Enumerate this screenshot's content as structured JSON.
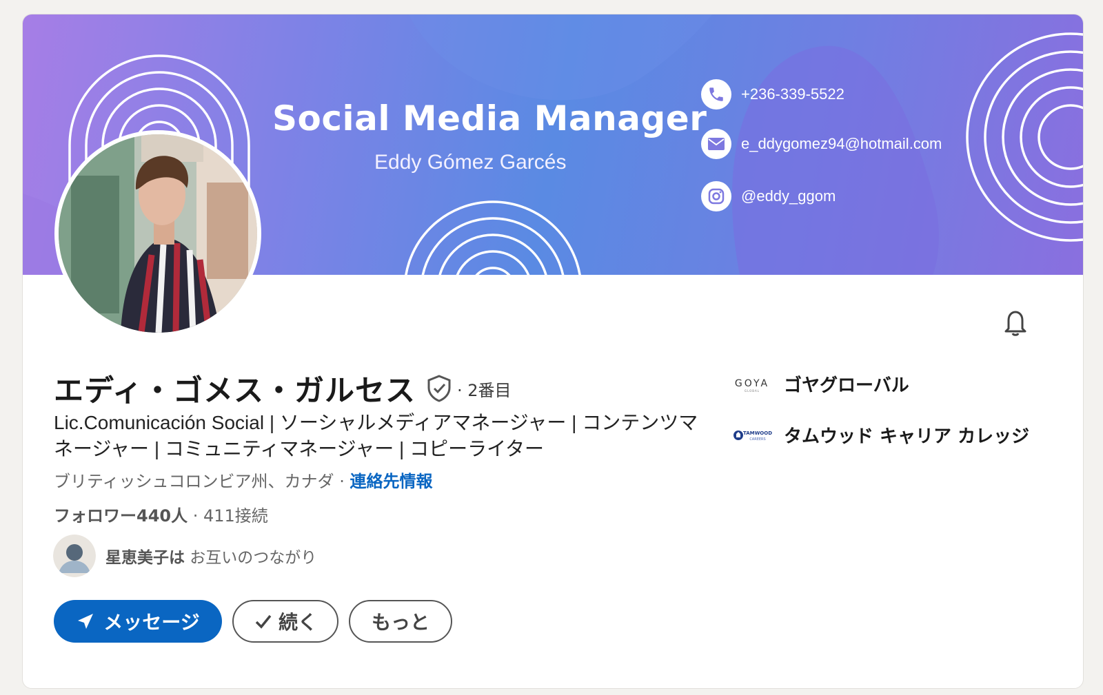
{
  "banner": {
    "title": "Social Media Manager",
    "subtitle": "Eddy Gómez Garcés",
    "contacts": [
      {
        "icon": "phone-icon",
        "text": "+236-339-5522"
      },
      {
        "icon": "mail-icon",
        "text": "e_ddygomez94@hotmail.com"
      },
      {
        "icon": "instagram-icon",
        "text": "@eddy_ggom"
      }
    ]
  },
  "profile": {
    "name": "エディ・ゴメス・ガルセス",
    "degree": "· 2番目",
    "headline": "Lic.Comunicación Social | ソーシャルメディアマネージャー | コンテンツマネージャー | コミュニティマネージャー | コピーライター",
    "location": "ブリティッシュコロンビア州、カナダ · ",
    "contact_link": "連絡先情報",
    "followers": "フォロワー440人",
    "connections": " · 411接続",
    "mutual_name": "星恵美子は",
    "mutual_text": " お互いのつながり"
  },
  "actions": {
    "message": "メッセージ",
    "follow": "続く",
    "more": "もっと"
  },
  "organizations": [
    {
      "logo_text": "GOYA",
      "logo_sub": "GLOBAL",
      "name": "ゴヤグローバル"
    },
    {
      "logo_text": "TAMWOOD",
      "logo_sub": "CAREERS",
      "name": "タムウッド キャリア カレッジ"
    }
  ],
  "colors": {
    "primary": "#0a66c2",
    "banner_start": "#a67ee6",
    "banner_mid": "#5a8ae3",
    "banner_end": "#8a6fdf"
  }
}
